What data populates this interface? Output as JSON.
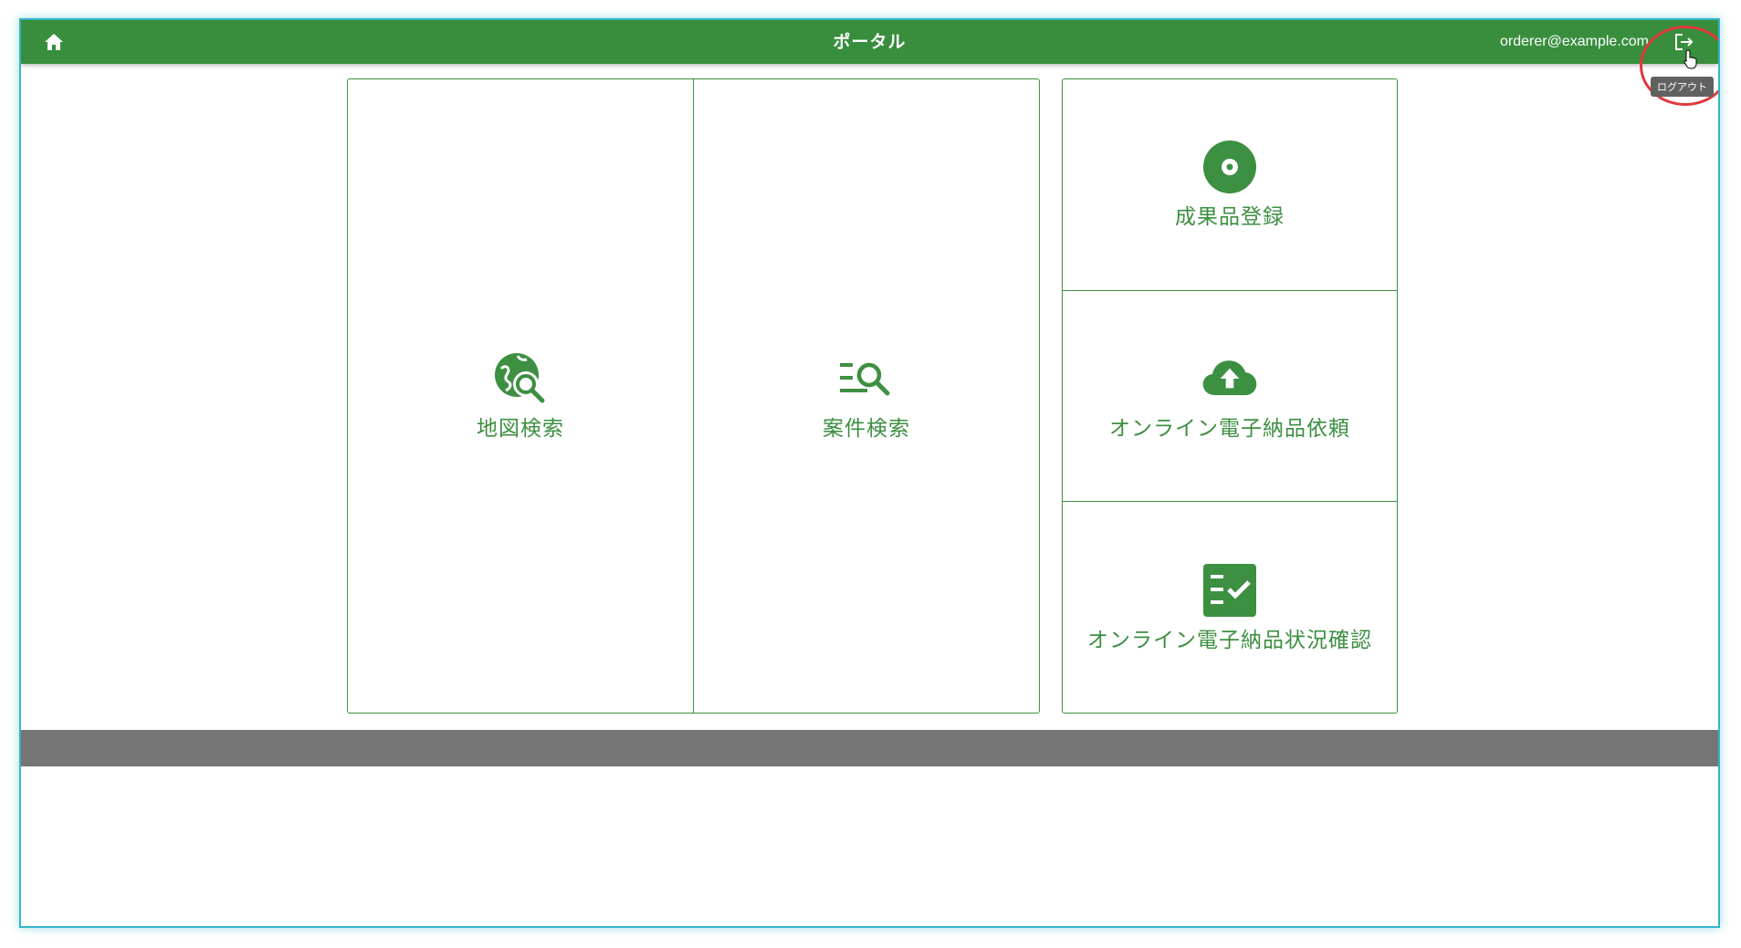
{
  "header": {
    "title": "ポータル",
    "user_email": "orderer@example.com",
    "logout_tooltip": "ログアウト",
    "background_color": "#388e3c"
  },
  "tiles": {
    "map_search": {
      "label": "地図検索",
      "icon": "map-search-icon"
    },
    "project_search": {
      "label": "案件検索",
      "icon": "list-search-icon"
    },
    "deliverable_registration": {
      "label": "成果品登録",
      "icon": "disc-icon"
    },
    "online_delivery_request": {
      "label": "オンライン電子納品依頼",
      "icon": "cloud-upload-icon"
    },
    "online_delivery_status": {
      "label": "オンライン電子納品状況確認",
      "icon": "checklist-icon"
    }
  },
  "colors": {
    "accent": "#3d8f41",
    "footer": "#757575",
    "highlight": "#e0383e"
  }
}
